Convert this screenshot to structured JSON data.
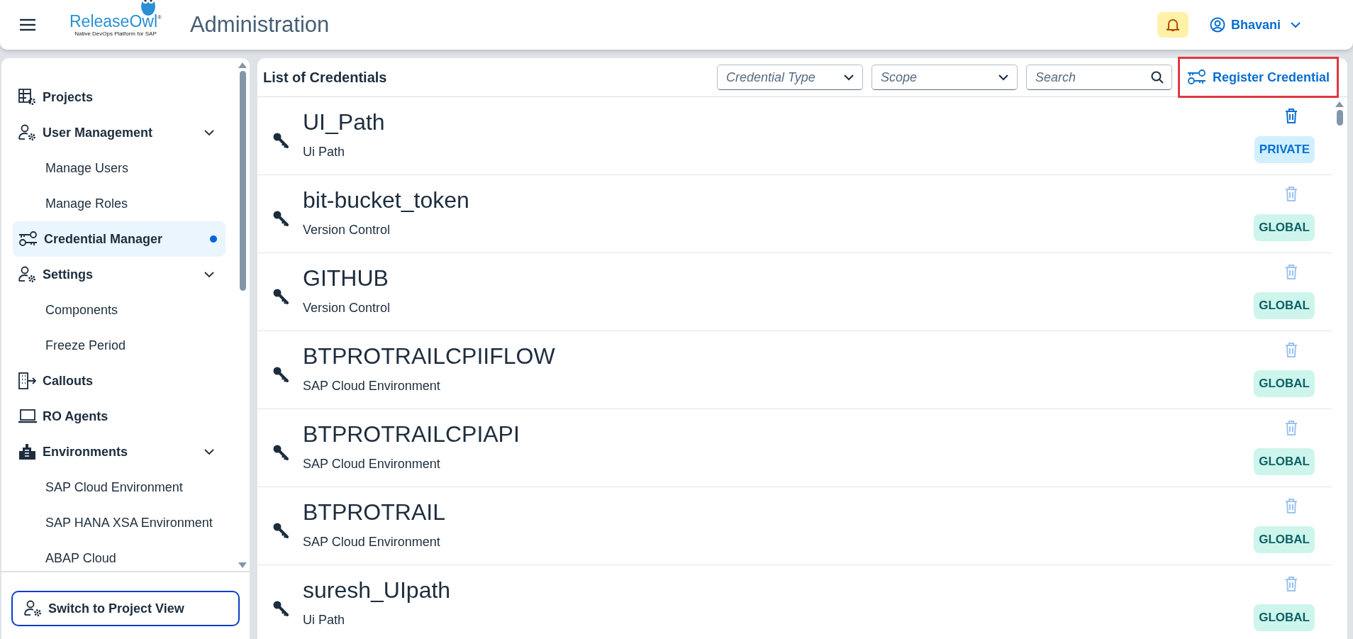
{
  "header": {
    "logo": {
      "name": "ReleaseOwl",
      "mark": "®",
      "tagline": "Native DevOps Platform for SAP"
    },
    "title": "Administration",
    "user": {
      "name": "Bhavani"
    }
  },
  "sidebar": {
    "items": [
      {
        "label": "Projects",
        "selected": false
      },
      {
        "label": "User Management",
        "selected": false,
        "expanded": true,
        "children": [
          {
            "label": "Manage Users",
            "selected": false
          },
          {
            "label": "Manage Roles",
            "selected": false
          }
        ]
      },
      {
        "label": "Credential Manager",
        "selected": true
      },
      {
        "label": "Settings",
        "selected": false,
        "expanded": true,
        "children": [
          {
            "label": "Components",
            "selected": false
          },
          {
            "label": "Freeze Period",
            "selected": false
          }
        ]
      },
      {
        "label": "Callouts",
        "selected": false
      },
      {
        "label": "RO Agents",
        "selected": false
      },
      {
        "label": "Environments",
        "selected": false,
        "expanded": true,
        "children": [
          {
            "label": "SAP Cloud Environment",
            "selected": false
          },
          {
            "label": "SAP HANA XSA Environment",
            "selected": false
          },
          {
            "label": "ABAP Cloud",
            "selected": false
          }
        ]
      }
    ],
    "footer_button": "Switch to Project View"
  },
  "list": {
    "title": "List of Credentials",
    "filters": [
      {
        "kind": "dropdown",
        "placeholder": "Credential Type"
      },
      {
        "kind": "dropdown",
        "placeholder": "Scope"
      },
      {
        "kind": "search",
        "placeholder": "Search"
      }
    ],
    "register_button": {
      "label": "Register Credential",
      "highlighted": true
    },
    "credentials": [
      {
        "name": "UI_Path",
        "type": "Ui Path",
        "scope": "PRIVATE",
        "kind": "private",
        "delete_disabled": false
      },
      {
        "name": "bit-bucket_token",
        "type": "Version Control",
        "scope": "GLOBAL",
        "kind": "global",
        "delete_disabled": true
      },
      {
        "name": "GITHUB",
        "type": "Version Control",
        "scope": "GLOBAL",
        "kind": "global",
        "delete_disabled": true
      },
      {
        "name": "BTPROTRAILCPIIFLOW",
        "type": "SAP Cloud Environment",
        "scope": "GLOBAL",
        "kind": "global",
        "delete_disabled": true
      },
      {
        "name": "BTPROTRAILCPIAPI",
        "type": "SAP Cloud Environment",
        "scope": "GLOBAL",
        "kind": "global",
        "delete_disabled": true
      },
      {
        "name": "BTPROTRAIL",
        "type": "SAP Cloud Environment",
        "scope": "GLOBAL",
        "kind": "global",
        "delete_disabled": true
      },
      {
        "name": "suresh_UIpath",
        "type": "Ui Path",
        "scope": "GLOBAL",
        "kind": "global",
        "delete_disabled": true
      }
    ]
  }
}
